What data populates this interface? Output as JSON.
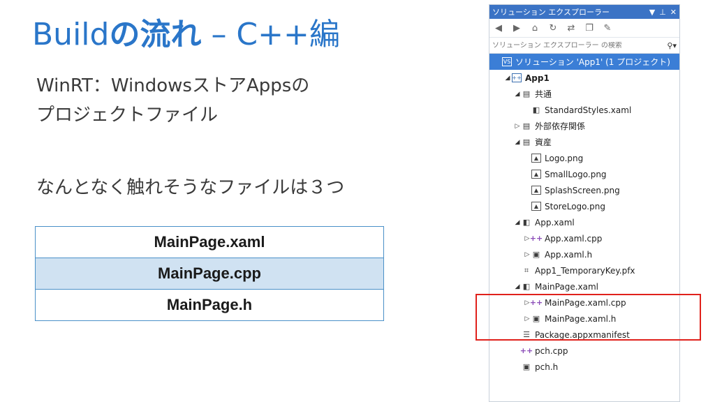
{
  "slide": {
    "title_main": "Build",
    "title_bold": "の流れ",
    "title_rest": " – C++編",
    "line1": "WinRT：WindowsストアAppsの",
    "line2": "プロジェクトファイル",
    "line3": "なんとなく触れそうなファイルは３つ",
    "files": [
      "MainPage.xaml",
      "MainPage.cpp",
      "MainPage.h"
    ]
  },
  "solution_explorer": {
    "title": "ソリューション エクスプローラー",
    "search_placeholder": "ソリューション エクスプローラー の検索",
    "tree": [
      {
        "label": "ソリューション 'App1' (1 プロジェクト)",
        "indent": 0,
        "expander": "",
        "icon": "solution-icon",
        "selected": true
      },
      {
        "label": "App1",
        "indent": 1,
        "expander": "◢",
        "icon": "project-icon",
        "bold": true
      },
      {
        "label": "共通",
        "indent": 2,
        "expander": "◢",
        "icon": "folder-icon"
      },
      {
        "label": "StandardStyles.xaml",
        "indent": 3,
        "expander": "",
        "icon": "xaml-icon"
      },
      {
        "label": "外部依存関係",
        "indent": 2,
        "expander": "▷",
        "icon": "folder-icon"
      },
      {
        "label": "資産",
        "indent": 2,
        "expander": "◢",
        "icon": "folder-icon"
      },
      {
        "label": "Logo.png",
        "indent": 3,
        "expander": "",
        "icon": "image-icon"
      },
      {
        "label": "SmallLogo.png",
        "indent": 3,
        "expander": "",
        "icon": "image-icon"
      },
      {
        "label": "SplashScreen.png",
        "indent": 3,
        "expander": "",
        "icon": "image-icon"
      },
      {
        "label": "StoreLogo.png",
        "indent": 3,
        "expander": "",
        "icon": "image-icon"
      },
      {
        "label": "App.xaml",
        "indent": 2,
        "expander": "◢",
        "icon": "xaml-icon"
      },
      {
        "label": "App.xaml.cpp",
        "indent": 3,
        "expander": "▷",
        "icon": "cpp-icon"
      },
      {
        "label": "App.xaml.h",
        "indent": 3,
        "expander": "▷",
        "icon": "header-icon"
      },
      {
        "label": "App1_TemporaryKey.pfx",
        "indent": 2,
        "expander": "",
        "icon": "key-icon"
      },
      {
        "label": "MainPage.xaml",
        "indent": 2,
        "expander": "◢",
        "icon": "xaml-icon"
      },
      {
        "label": "MainPage.xaml.cpp",
        "indent": 3,
        "expander": "▷",
        "icon": "cpp-icon"
      },
      {
        "label": "MainPage.xaml.h",
        "indent": 3,
        "expander": "▷",
        "icon": "header-icon"
      },
      {
        "label": "Package.appxmanifest",
        "indent": 2,
        "expander": "",
        "icon": "manifest-icon"
      },
      {
        "label": "pch.cpp",
        "indent": 2,
        "expander": "",
        "icon": "cpp-icon"
      },
      {
        "label": "pch.h",
        "indent": 2,
        "expander": "",
        "icon": "header-icon"
      }
    ]
  }
}
